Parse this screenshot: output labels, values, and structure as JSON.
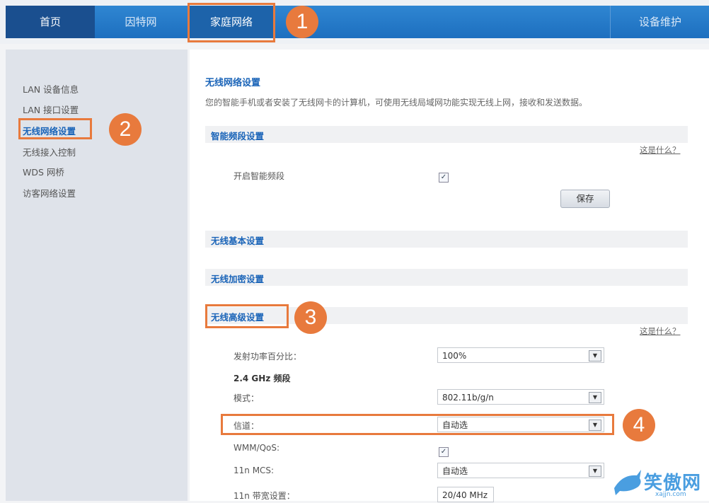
{
  "nav": {
    "tabs": [
      {
        "label": "首页"
      },
      {
        "label": "因特网"
      },
      {
        "label": "家庭网络"
      }
    ],
    "right_label": "设备维护"
  },
  "sidebar": {
    "items": [
      {
        "label": "LAN 设备信息"
      },
      {
        "label": "LAN 接口设置"
      },
      {
        "label": "无线网络设置"
      },
      {
        "label": "无线接入控制"
      },
      {
        "label": "WDS 网桥"
      },
      {
        "label": "访客网络设置"
      }
    ]
  },
  "main": {
    "title": "无线网络设置",
    "description": "您的智能手机或者安装了无线网卡的计算机，可使用无线局域网功能实现无线上网，接收和发送数据。",
    "smart_power": {
      "label": "智能频段设置",
      "help": "这是什么？",
      "field_label": "开启智能频段",
      "save": "保存"
    },
    "basic": {
      "label": "无线基本设置"
    },
    "encryption": {
      "label": "无线加密设置"
    },
    "advanced": {
      "label": "无线高级设置",
      "help": "这是什么？",
      "rows": {
        "power_label": "发射功率百分比：",
        "power_value": "100%",
        "band_title": "2.4 GHz 频段",
        "mode_label": "模式：",
        "mode_value": "802.11b/g/n",
        "channel_label": "信道：",
        "channel_value": "自动选",
        "wmm_label": "WMM/QoS:",
        "mcs_label": "11n MCS:",
        "mcs_value": "自动选",
        "bw_label": "11n 带宽设置：",
        "bw_value": "20/40 MHz"
      }
    }
  },
  "annotations": {
    "b1": "1",
    "b2": "2",
    "b3": "3",
    "b4": "4",
    "accent": "#e87a3d"
  },
  "watermark": {
    "text": "笑傲网",
    "url": "xajjn.com"
  }
}
